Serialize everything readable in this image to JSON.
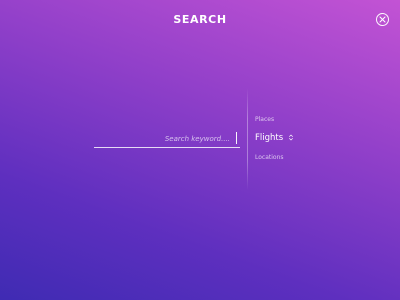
{
  "header": {
    "title": "SEARCH"
  },
  "search": {
    "placeholder": "Search keyword....",
    "value": ""
  },
  "picker": {
    "items_above": [
      "",
      "",
      "Places"
    ],
    "selected": "Flights",
    "items_below": [
      "Locations",
      "",
      ""
    ]
  },
  "icons": {
    "close": "close-circle-icon",
    "selector": "chevron-up-down-icon"
  }
}
